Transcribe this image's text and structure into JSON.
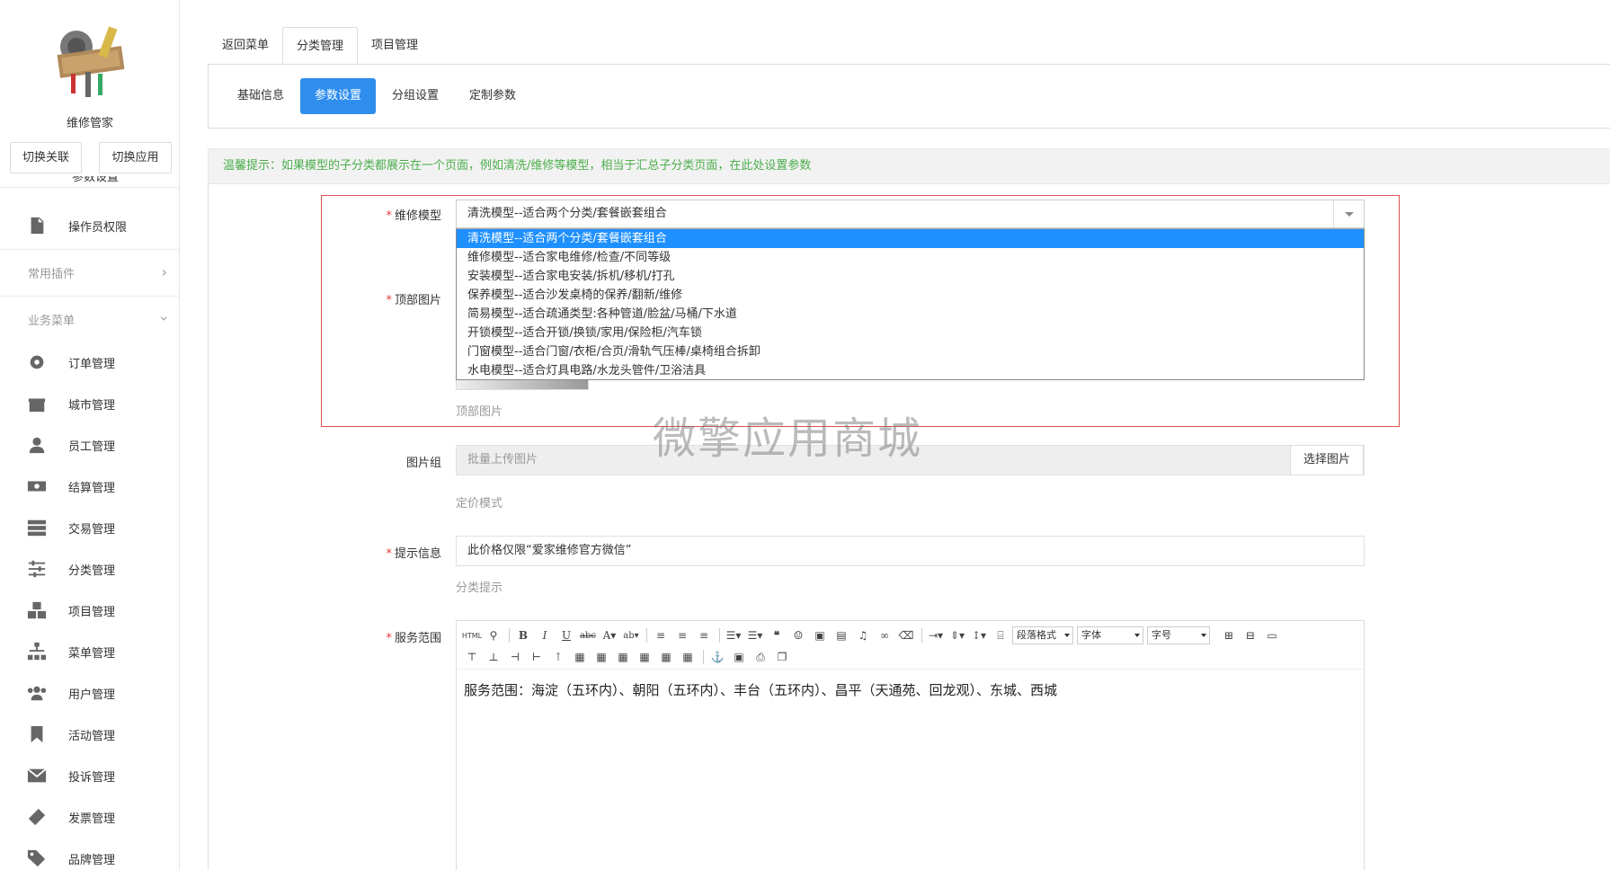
{
  "app": {
    "name": "维修管家",
    "switch_link_label": "切换关联",
    "switch_app_label": "切换应用"
  },
  "sidebar": {
    "cut_item_label": "参数设置",
    "items_top": [
      {
        "label": "操作员权限",
        "icon": "file-icon"
      }
    ],
    "group_plugins": "常用插件",
    "group_business": "业务菜单",
    "items": [
      {
        "label": "订单管理",
        "icon": "gear-icon"
      },
      {
        "label": "城市管理",
        "icon": "gift-icon"
      },
      {
        "label": "员工管理",
        "icon": "user-icon"
      },
      {
        "label": "结算管理",
        "icon": "money-icon"
      },
      {
        "label": "交易管理",
        "icon": "server-icon"
      },
      {
        "label": "分类管理",
        "icon": "sliders-icon"
      },
      {
        "label": "项目管理",
        "icon": "cubes-icon"
      },
      {
        "label": "菜单管理",
        "icon": "sitemap-icon"
      },
      {
        "label": "用户管理",
        "icon": "users-icon"
      },
      {
        "label": "活动管理",
        "icon": "bookmark-icon"
      },
      {
        "label": "投诉管理",
        "icon": "envelope-icon"
      },
      {
        "label": "发票管理",
        "icon": "ticket-icon"
      },
      {
        "label": "品牌管理",
        "icon": "tags-icon"
      }
    ]
  },
  "top_tabs": [
    {
      "label": "返回菜单"
    },
    {
      "label": "分类管理"
    },
    {
      "label": "项目管理"
    }
  ],
  "sub_tabs": [
    {
      "label": "基础信息"
    },
    {
      "label": "参数设置"
    },
    {
      "label": "分组设置"
    },
    {
      "label": "定制参数"
    }
  ],
  "notice": "温馨提示：如果模型的子分类都展示在一个页面，例如清洗/维修等模型，相当于汇总子分类页面，在此处设置参数",
  "form": {
    "model_label": "维修模型",
    "model_value": "清洗模型--适合两个分类/套餐嵌套组合",
    "model_options": [
      "清洗模型--适合两个分类/套餐嵌套组合",
      "维修模型--适合家电维修/检查/不同等级",
      "安装模型--适合家电安装/拆机/移机/打孔",
      "保养模型--适合沙发桌椅的保养/翻新/维修",
      "简易模型--适合疏通类型:各种管道/脸盆/马桶/下水道",
      "开锁模型--适合开锁/换锁/家用/保险柜/汽车锁",
      "门窗模型--适合门窗/衣柜/合页/滑轨气压棒/桌椅组合拆卸",
      "水电模型--适合灯具电路/水龙头管件/卫浴洁具"
    ],
    "top_image_label": "顶部图片",
    "top_image_hint": "顶部图片",
    "gallery_label": "图片组",
    "gallery_placeholder": "批量上传图片",
    "gallery_button": "选择图片",
    "gallery_hint": "定价模式",
    "tip_label": "提示信息",
    "tip_value": "此价格仅限“爱家维修官方微信”",
    "tip_hint": "分类提示",
    "service_label": "服务范围",
    "service_content": "服务范围：海淀（五环内）、朝阳（五环内）、丰台（五环内）、昌平（天通苑、回龙观）、东城、西城"
  },
  "editor_toolbar": {
    "html_label": "HTML",
    "paragraph_label": "段落格式",
    "font_label": "字体",
    "size_label": "字号"
  },
  "watermark": "微擎应用商城",
  "colors": {
    "accent": "#2e8ded",
    "notice_text": "#4cae4c",
    "required": "#e4393c",
    "error_border": "#d9534f",
    "option_selected": "#1e90ff"
  }
}
